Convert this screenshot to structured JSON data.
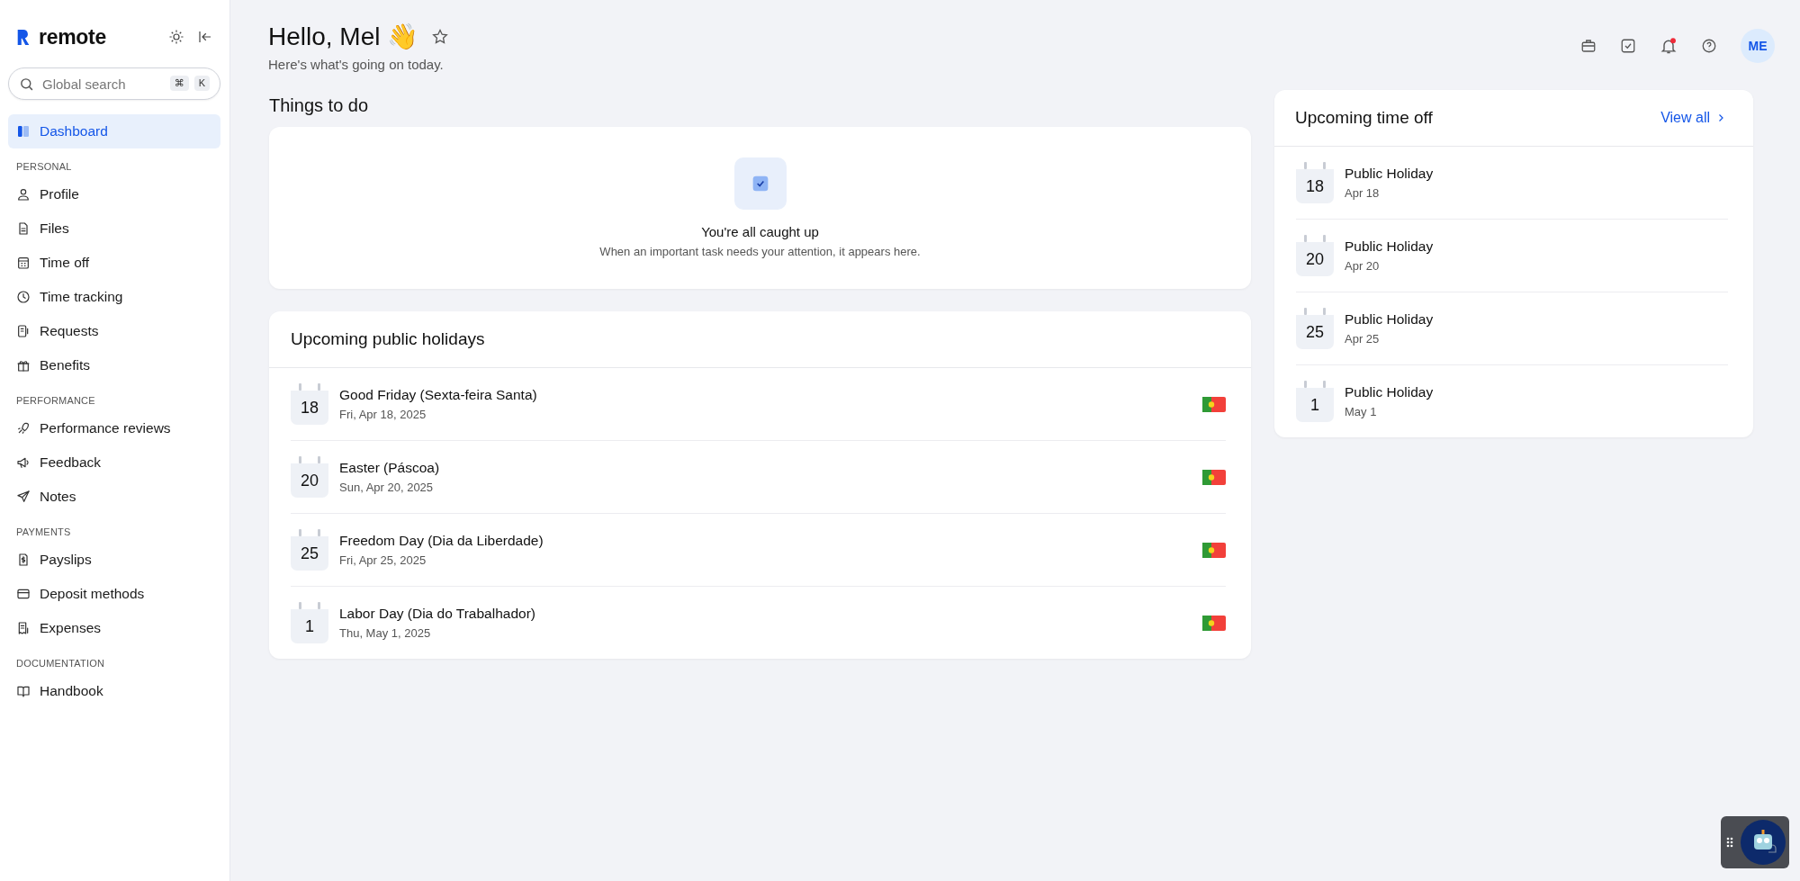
{
  "sidebar": {
    "brand": "remote",
    "search": {
      "placeholder": "Global search",
      "keys": [
        "⌘",
        "K"
      ]
    },
    "sections": [
      {
        "items": [
          {
            "label": "Dashboard",
            "selected": true
          }
        ]
      },
      {
        "heading": "PERSONAL",
        "items": [
          {
            "label": "Profile",
            "selected": false
          },
          {
            "label": "Files",
            "selected": false
          },
          {
            "label": "Time off",
            "selected": false
          },
          {
            "label": "Time tracking",
            "selected": false
          },
          {
            "label": "Requests",
            "selected": false
          },
          {
            "label": "Benefits",
            "selected": false
          }
        ]
      },
      {
        "heading": "PERFORMANCE",
        "items": [
          {
            "label": "Performance reviews",
            "selected": false
          },
          {
            "label": "Feedback",
            "selected": false
          },
          {
            "label": "Notes",
            "selected": false
          }
        ]
      },
      {
        "heading": "PAYMENTS",
        "items": [
          {
            "label": "Payslips",
            "selected": false
          },
          {
            "label": "Deposit methods",
            "selected": false
          },
          {
            "label": "Expenses",
            "selected": false
          }
        ]
      },
      {
        "heading": "DOCUMENTATION",
        "items": [
          {
            "label": "Handbook",
            "selected": false
          }
        ]
      }
    ]
  },
  "header": {
    "title": "Hello, Mel",
    "emoji": "👋",
    "subtitle": "Here's what's going on today.",
    "notifications_unread": true,
    "avatar": "ME"
  },
  "things_to_do": {
    "title": "Things to do",
    "empty_title": "You're all caught up",
    "empty_text": "When an important task needs your attention, it appears here."
  },
  "public_holidays": {
    "title": "Upcoming public holidays",
    "items": [
      {
        "day": "18",
        "name": "Good Friday (Sexta-feira Santa)",
        "date": "Fri, Apr 18, 2025"
      },
      {
        "day": "20",
        "name": "Easter (Páscoa)",
        "date": "Sun, Apr 20, 2025"
      },
      {
        "day": "25",
        "name": "Freedom Day (Dia da Liberdade)",
        "date": "Fri, Apr 25, 2025"
      },
      {
        "day": "1",
        "name": "Labor Day (Dia do Trabalhador)",
        "date": "Thu, May 1, 2025"
      }
    ]
  },
  "time_off": {
    "title": "Upcoming time off",
    "link": "View all",
    "items": [
      {
        "day": "18",
        "name": "Public Holiday",
        "date": "Apr 18"
      },
      {
        "day": "20",
        "name": "Public Holiday",
        "date": "Apr 20"
      },
      {
        "day": "25",
        "name": "Public Holiday",
        "date": "Apr 25"
      },
      {
        "day": "1",
        "name": "Public Holiday",
        "date": "May 1"
      }
    ]
  }
}
